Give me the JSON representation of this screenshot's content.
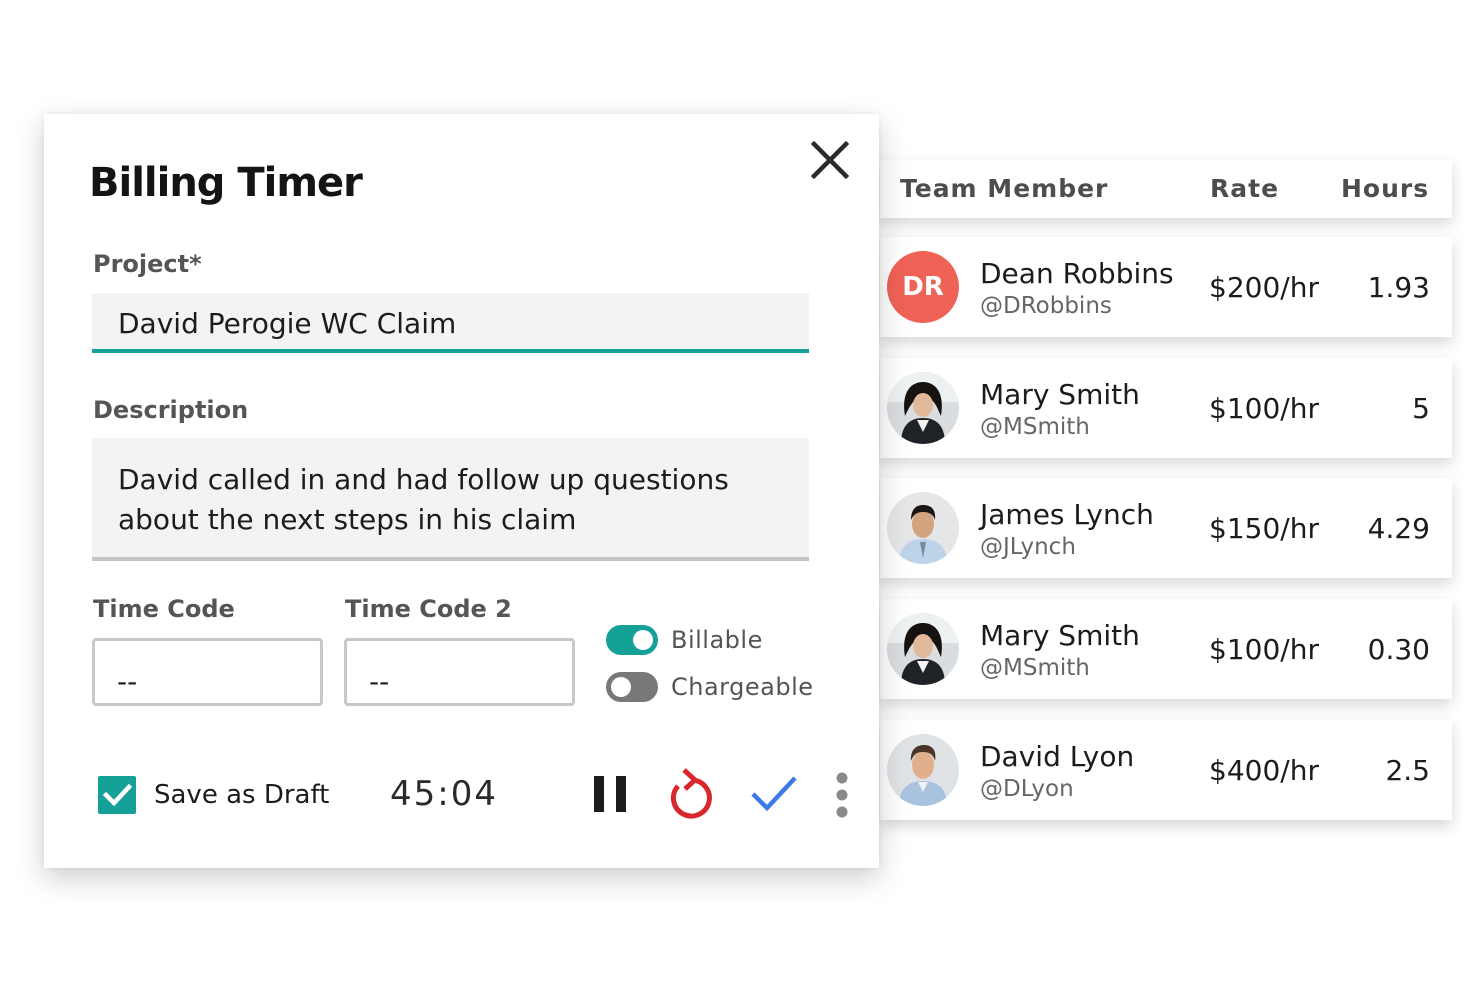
{
  "timer": {
    "title": "Billing Timer",
    "project_label": "Project*",
    "project_value": "David Perogie WC Claim",
    "description_label": "Description",
    "description_value": "David called in and had follow up questions about the next steps in his claim",
    "time_code_label": "Time Code",
    "time_code_value": "--",
    "time_code2_label": "Time Code 2",
    "time_code2_value": "--",
    "billable_label": "Billable",
    "billable_on": true,
    "chargeable_label": "Chargeable",
    "chargeable_on": false,
    "draft_label": "Save as Draft",
    "draft_checked": true,
    "elapsed": "45:04",
    "icons": {
      "close": "close-icon",
      "pause": "pause-icon",
      "reset": "reset-icon",
      "confirm": "check-icon",
      "more": "more-vertical-icon"
    }
  },
  "team": {
    "headers": {
      "member": "Team Member",
      "rate": "Rate",
      "hours": "Hours"
    },
    "rows": [
      {
        "initials": "DR",
        "name": "Dean Robbins",
        "handle": "@DRobbins",
        "rate": "$200/hr",
        "hours": "1.93"
      },
      {
        "initials": "",
        "name": "Mary Smith",
        "handle": "@MSmith",
        "rate": "$100/hr",
        "hours": "5"
      },
      {
        "initials": "",
        "name": "James Lynch",
        "handle": "@JLynch",
        "rate": "$150/hr",
        "hours": "4.29"
      },
      {
        "initials": "",
        "name": "Mary Smith",
        "handle": "@MSmith",
        "rate": "$100/hr",
        "hours": "0.30"
      },
      {
        "initials": "",
        "name": "David Lyon",
        "handle": "@DLyon",
        "rate": "$400/hr",
        "hours": "2.5"
      }
    ]
  },
  "colors": {
    "accent": "#16a198",
    "avatar_initials_bg": "#ef6256",
    "reset_icon": "#d8282d",
    "confirm_icon": "#3b7be8"
  }
}
